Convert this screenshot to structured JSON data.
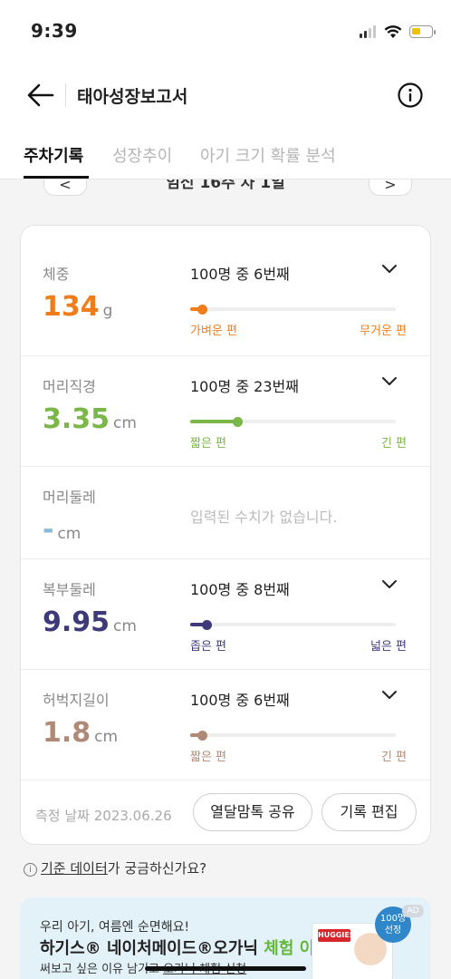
{
  "status_bar": {
    "time": "9:39"
  },
  "header": {
    "title": "태아성장보고서"
  },
  "tabs": [
    {
      "label": "주차기록",
      "active": true
    },
    {
      "label": "성장추이",
      "active": false
    },
    {
      "label": "아기 크기 확률 분석",
      "active": false
    }
  ],
  "week_nav": {
    "label": "임신 16주 차 1일",
    "prev": "<",
    "next": ">"
  },
  "measurements": [
    {
      "label": "체중",
      "value": "134",
      "unit": "g",
      "rank": "100명 중 6번째",
      "low": "가벼운 편",
      "high": "무거운 편",
      "color": "#f07d1c",
      "percentile": 0.06
    },
    {
      "label": "머리직경",
      "value": "3.35",
      "unit": "cm",
      "rank": "100명 중 23번째",
      "low": "짧은 편",
      "high": "긴 편",
      "color": "#7ab648",
      "percentile": 0.23
    },
    {
      "label": "머리둘레",
      "value": "-",
      "unit": "cm",
      "empty_message": "입력된 수치가 없습니다.",
      "color": "#8bb8d8"
    },
    {
      "label": "복부둘레",
      "value": "9.95",
      "unit": "cm",
      "rank": "100명 중 8번째",
      "low": "좁은 편",
      "high": "넓은 편",
      "color": "#3e3a7a",
      "percentile": 0.08
    },
    {
      "label": "허벅지길이",
      "value": "1.8",
      "unit": "cm",
      "rank": "100명 중 6번째",
      "low": "짧은 편",
      "high": "긴 편",
      "color": "#b08a76",
      "percentile": 0.06
    }
  ],
  "footer": {
    "date_label": "측정 날짜 2023.06.26",
    "share_button": "열달맘톡 공유",
    "edit_button": "기록 편집"
  },
  "question": {
    "link_text": "기준 데이터",
    "rest_text": "가 궁금하신가요?"
  },
  "ad": {
    "line1": "우리 아기, 여름엔 순면해요!",
    "line2_prefix": "하기스® 네이처메이드®오가닉 ",
    "line2_highlight": "체험 이벤트",
    "line3_prefix": "써보고 싶은 이유 남기고 ",
    "line3_link": "오가닉 체험 신청",
    "badge": "100명 선정",
    "ad_mark": "AD",
    "product_brand": "HUGGIES"
  }
}
